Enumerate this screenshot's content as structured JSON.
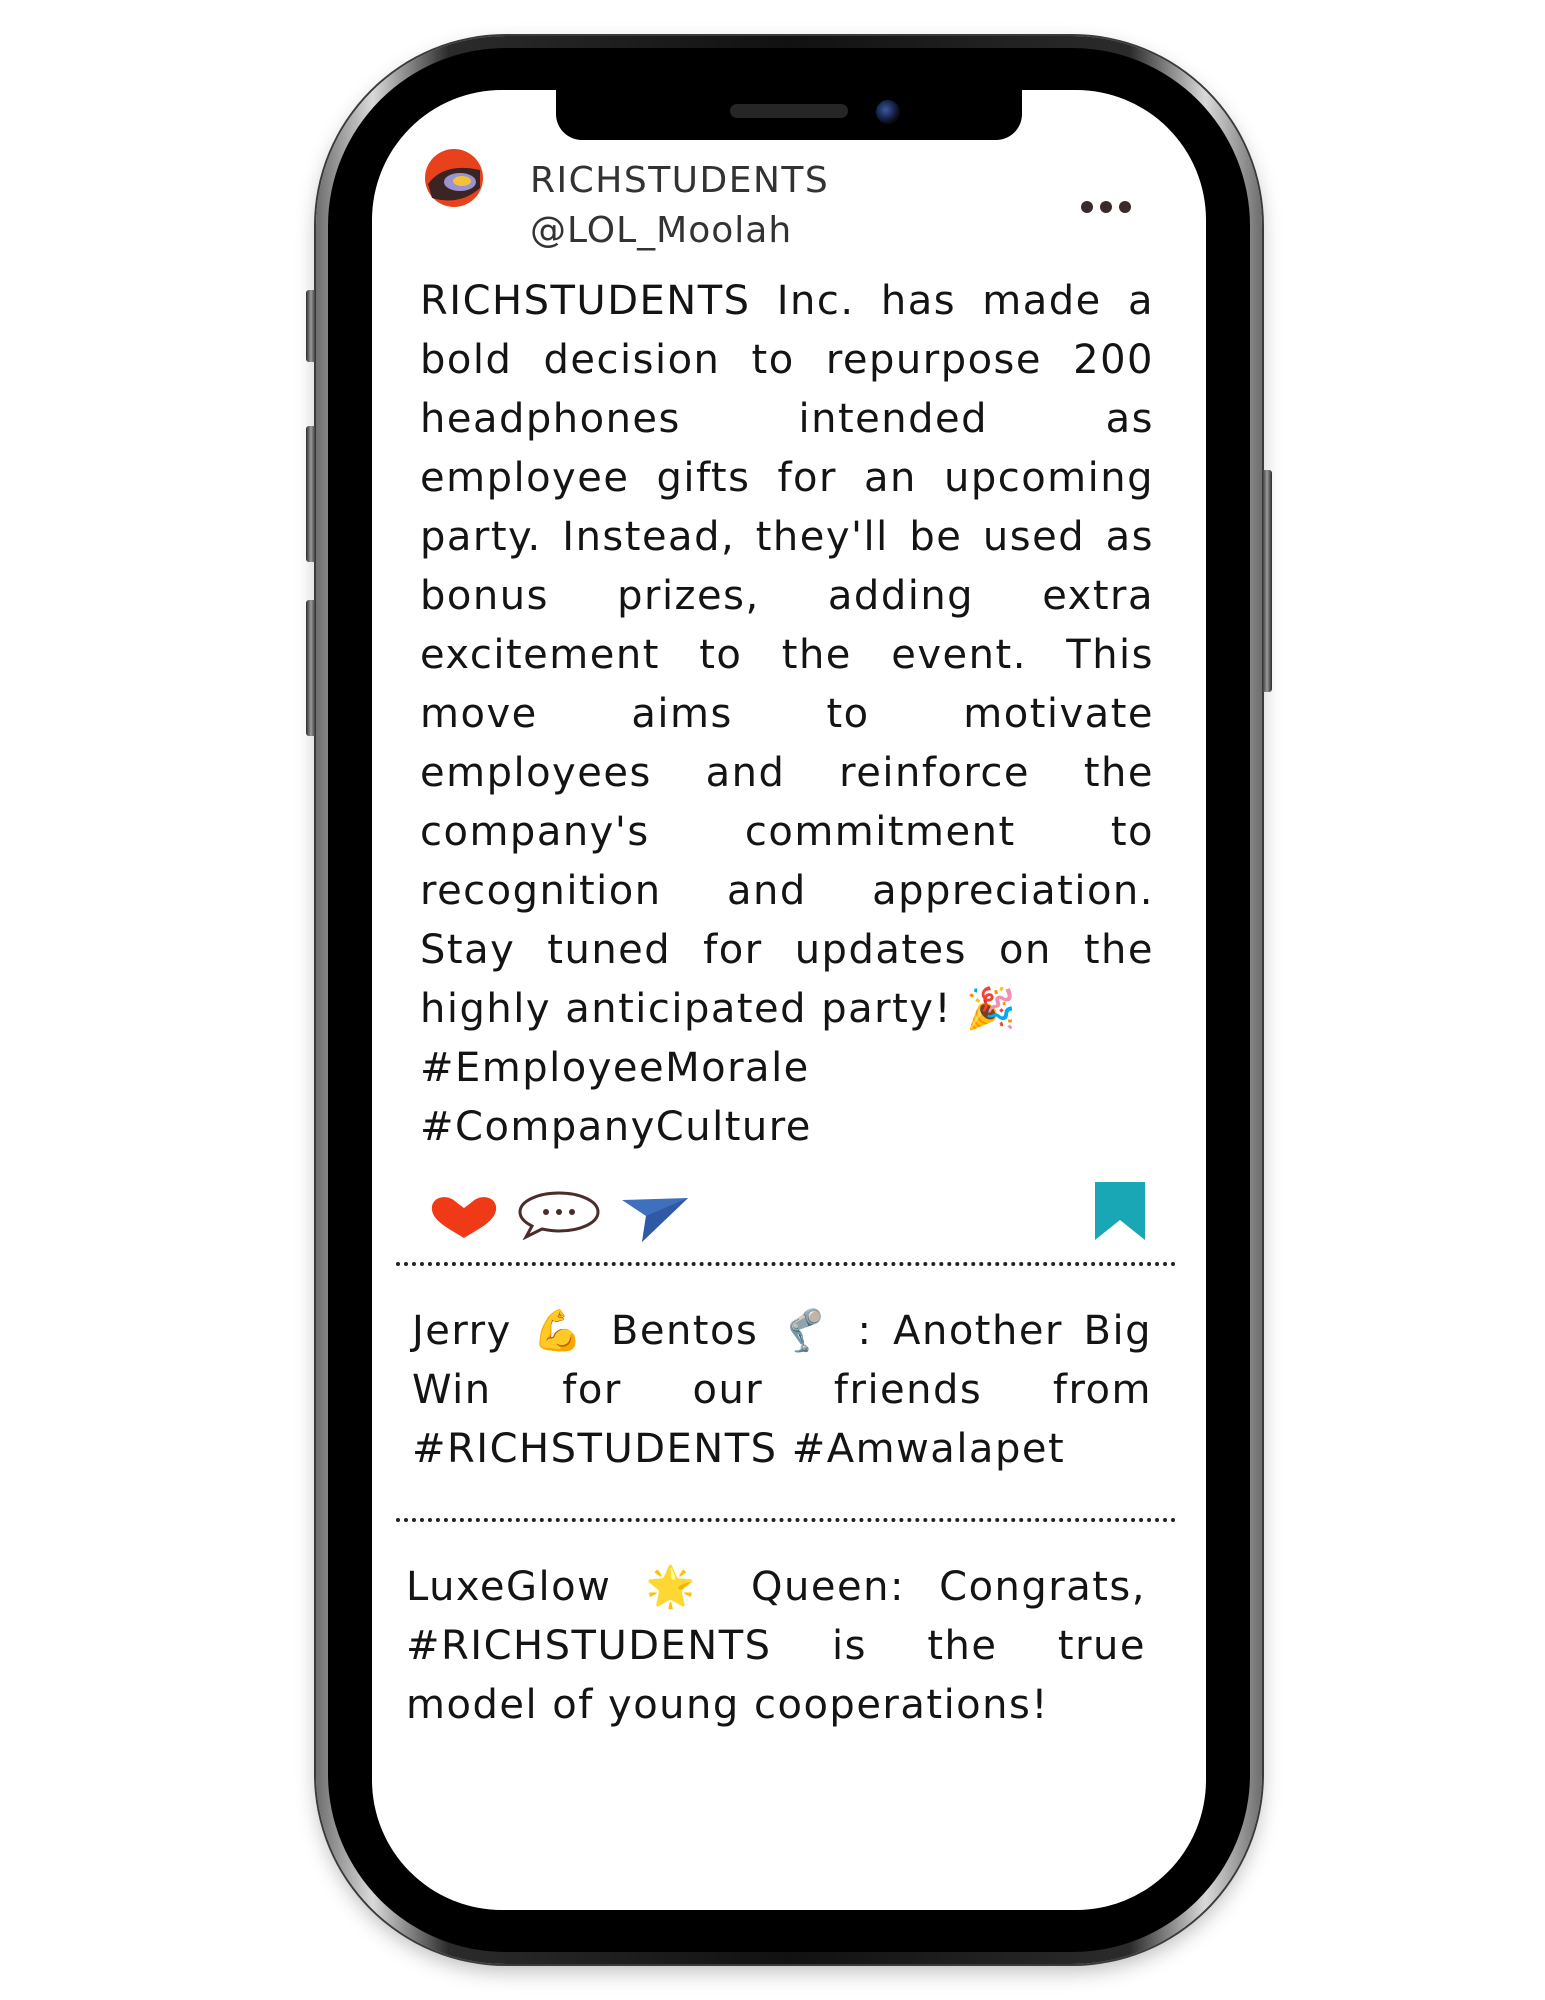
{
  "post": {
    "author_name": "RICHSTUDENTS",
    "author_handle": "@LOL_Moolah",
    "text": "RICHSTUDENTS Inc. has made a bold decision to repurpose 200 headphones intended as employee gifts for an upcoming party. Instead, they'll be used as bonus prizes, adding extra excitement to the event. This move aims to motivate employees and reinforce the company's commitment to recognition and appreciation. Stay tuned for updates on the highly anticipated party!",
    "emoji": "🎉",
    "hashtag_1": "#EmployeeMorale",
    "hashtag_2": "#CompanyCulture"
  },
  "actions": {
    "like_icon": "heart-icon",
    "comment_icon": "speech-bubble-icon",
    "share_icon": "paper-plane-icon",
    "save_icon": "bookmark-icon"
  },
  "comments": [
    {
      "name_part1": "Jerry",
      "emoji1": "💪",
      "name_part2": "Bentos",
      "emoji2": "🦿",
      "text": ": Another Big Win for our friends from #RICHSTUDENTS #Amwalapet"
    },
    {
      "name_part1": "LuxeGlow",
      "emoji1": "🌟",
      "name_part2": "Queen:",
      "text": "Congrats, #RICHSTUDENTS is the true model of young cooperations!"
    }
  ],
  "colors": {
    "heart": "#f03a17",
    "comment_outline": "#4a2d2a",
    "share": "#3f6fbf",
    "bookmark": "#1aa7b5",
    "more_dots": "#3b2a2a"
  }
}
